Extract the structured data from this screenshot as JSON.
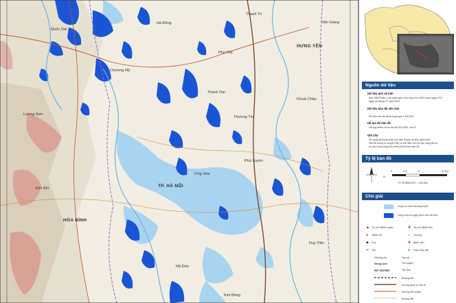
{
  "map": {
    "places": {
      "quoc_oai": "Quốc Oai",
      "ha_dong": "Hà Đông",
      "thuong_tin": "Thường Tín",
      "chuong_my": "Chương Mỹ",
      "thanh_oai": "Thanh Oai",
      "luong_son": "Lương Sơn",
      "kim_boi": "Kim Bôi",
      "ung_hoa": "Ứng Hòa",
      "phu_xuyen": "Phú Xuyên",
      "my_duc": "Mỹ Đức",
      "khoai_chau": "Khoái Châu",
      "van_giang": "Văn Giang",
      "kim_bang": "Kim Bảng",
      "duy_tien": "Duy Tiên",
      "hung_yen": "HƯNG YÊN",
      "hoa_binh": "HÒA BÌNH",
      "tp_ha_noi": "TP. HÀ NỘI",
      "thanh_tri": "Thanh Trì",
      "phu_tho_ward": "Phú Thọ"
    }
  },
  "panel": {
    "sources_title": "Nguồn dữ liệu",
    "src1_head": "Dữ liệu ảnh vệ tinh",
    "src1_lines": [
      "Ảnh SENTINEL-1 độ phân giải 10m chụp lúc 22h01 phút ngày 27/2",
      "ngày 26 tháng 07 năm 2024"
    ],
    "src2_head": "Dữ liệu bản đồ nền GIS",
    "src2_lines": [
      "Dữ liệu bản đồ địa lý Quốc gia 1:100.000"
    ],
    "src3_head": "Hệ tọa độ bản đồ",
    "src3_lines": [
      "Hệ quy chiếu và hệ tọa độ VN-2000, múi 6°"
    ],
    "note_head": "Ghi chú",
    "note_lines": [
      "Sử dụng kỹ thuật phân tích ảnh Radar vệ tinh (kênh ảnh",
      "của Hệ thống lũ chuyên đề) có thể hiểu hơn từ các vùng đối cư",
      "và các vùng nông thực trên phủ lệ trên bản đồ."
    ],
    "scale_title": "Tỷ lệ bản đồ",
    "scale_ticks": [
      "0",
      "2,5",
      "5",
      "10 Km"
    ],
    "scale_caption": "TỶ LỆ BẢN ĐỒ 1 : 100.000",
    "north_label": "N",
    "legend_title": "Chú giải",
    "legend_items": {
      "water_normal": "Vùng có nước thường xuyên",
      "flood": "Vùng nước bị ngập (theo ảnh vệ tinh)",
      "capital": "Trụ sở UBND tỉnh",
      "admin": "Trụ sở UBND huyện",
      "ward": "UBND xã",
      "school": "Trường",
      "hospital": "Bệnh viện",
      "market": "Chợ",
      "pagoda": "Chùa",
      "church": "Nhà thờ",
      "bridge": "Cầu",
      "station": "Trạm thủy văn"
    },
    "legend_text_samples": {
      "ward_name": "Phường Hà",
      "ward_label": "Tên xã",
      "district_name": "Đông Anh",
      "district_label": "Tên huyện",
      "province_name": "HÀ GIANG",
      "province_label": "Tên tỉnh"
    },
    "legend_lines": [
      "Đường sắt",
      "Đường quốc lộ, tỉnh lộ",
      "Đường liên huyện",
      "Đường đất"
    ]
  },
  "colors": {
    "flood": "#1a55d6",
    "water": "#a8d4f0",
    "header": "#1d4f8c",
    "terrain_red": "#d48a8a"
  }
}
